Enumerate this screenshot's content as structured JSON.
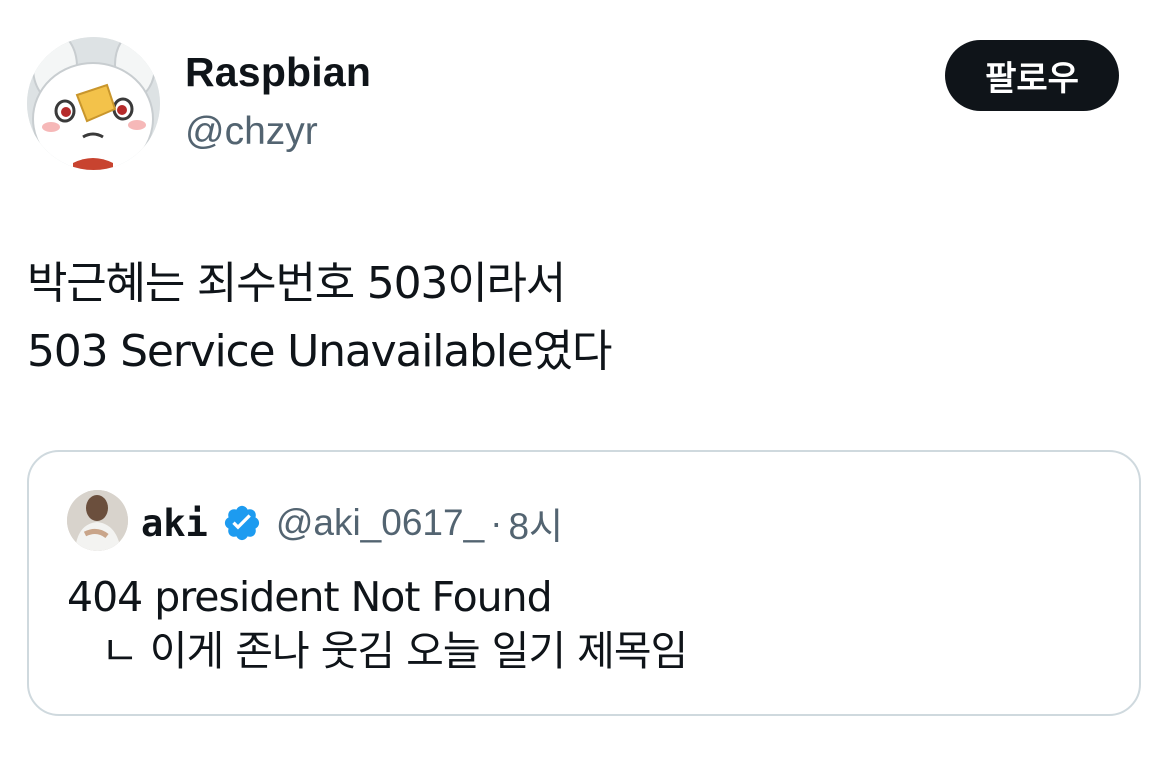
{
  "author": {
    "display_name": "Raspbian",
    "handle": "@chzyr",
    "avatar_icon": "cartoon-character-avatar"
  },
  "follow_button": {
    "label": "팔로우"
  },
  "tweet": {
    "lines": [
      "박근혜는 죄수번호 503이라서",
      "503 Service Unavailable였다"
    ]
  },
  "quoted_tweet": {
    "display_name": "aki",
    "handle": "@aki_0617_",
    "separator": "·",
    "time": "8시",
    "verified_icon": "verified-badge-icon",
    "verified_color": "#1d9bf0",
    "lines": [
      "404 president Not Found",
      "ㄴ 이게 존나 웃김 오늘 일기 제목임"
    ]
  },
  "colors": {
    "text": "#0f1419",
    "secondary_text": "#536471",
    "border": "#cfd9de",
    "button_bg": "#0f1419",
    "button_text": "#ffffff"
  }
}
